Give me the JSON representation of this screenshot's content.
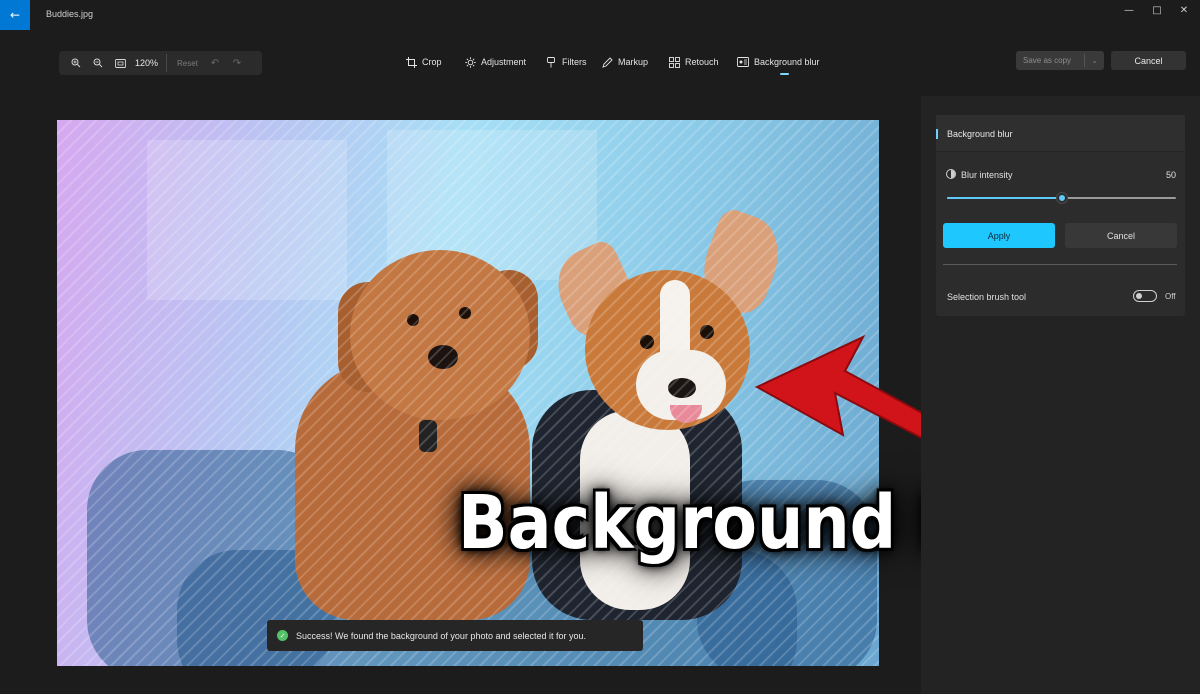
{
  "window": {
    "title": "Buddies.jpg",
    "back_icon": "back-arrow-icon",
    "controls": [
      "minimize-icon",
      "maximize-icon",
      "close-icon"
    ]
  },
  "zoom": {
    "level": "120%",
    "reset_label": "Reset"
  },
  "tools": [
    {
      "label": "Crop",
      "icon": "crop-icon"
    },
    {
      "label": "Adjustment",
      "icon": "brightness-icon"
    },
    {
      "label": "Filters",
      "icon": "filters-icon"
    },
    {
      "label": "Markup",
      "icon": "pen-icon"
    },
    {
      "label": "Retouch",
      "icon": "retouch-icon"
    },
    {
      "label": "Background blur",
      "icon": "background-blur-icon",
      "active": true
    }
  ],
  "actions": {
    "save_label": "Save as copy",
    "cancel_label": "Cancel"
  },
  "toast": {
    "message": "Success! We found the background of your photo and selected it for you."
  },
  "overlay": {
    "caption": "Background Blur"
  },
  "panel": {
    "title": "Background blur",
    "blur_intensity_label": "Blur intensity",
    "blur_intensity_value": "50",
    "slider_fraction": 0.5,
    "apply_label": "Apply",
    "cancel_label": "Cancel",
    "selection_brush_label": "Selection brush tool",
    "selection_brush_state": "Off"
  },
  "colors": {
    "accent": "#1ec8ff",
    "back_button": "#0078d4",
    "success": "#54c16a",
    "arrow": "#d0141a"
  }
}
